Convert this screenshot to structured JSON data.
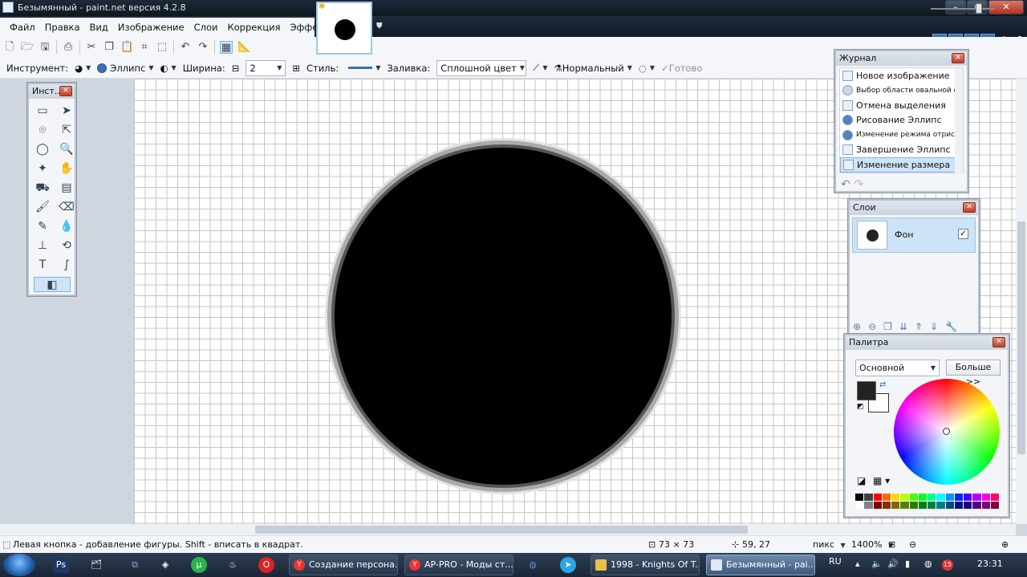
{
  "window": {
    "title": "Безымянный - paint.net версия 4.2.8",
    "buttons": [
      "–",
      "▫",
      "✕"
    ]
  },
  "menu": [
    "Файл",
    "Правка",
    "Вид",
    "Изображение",
    "Слои",
    "Коррекция",
    "Эффекты"
  ],
  "options": {
    "tool_label": "Инструмент:",
    "shape": "Эллипс",
    "width_label": "Ширина:",
    "width_value": "2",
    "style_label": "Стиль:",
    "fill_label": "Заливка:",
    "fill_value": "Сплошной цвет",
    "blend_mode": "Нормальный",
    "finish": "Готово"
  },
  "tools_panel": {
    "title": "Инст..."
  },
  "history": {
    "title": "Журнал",
    "items": [
      "Новое изображение",
      "Выбор области овальной формы",
      "Отмена выделения",
      "Рисование Эллипс",
      "Изменение режима отрисовки",
      "Завершение Эллипс",
      "Изменение размера"
    ]
  },
  "layers": {
    "title": "Слои",
    "layer_name": "Фон",
    "check": "✓"
  },
  "palette": {
    "title": "Палитра",
    "mode": "Основной",
    "more": "Больше >>",
    "swatches": [
      "#000000",
      "#404040",
      "#ff0000",
      "#ff6a00",
      "#ffd800",
      "#b6ff00",
      "#4cff00",
      "#00ff21",
      "#00ff90",
      "#00ffff",
      "#0094ff",
      "#0026ff",
      "#4800ff",
      "#b200ff",
      "#ff00dc",
      "#ff006e",
      "#ffffff",
      "#808080",
      "#7f0000",
      "#7f3300",
      "#7f6a00",
      "#5b7f00",
      "#267f00",
      "#007f0e",
      "#007f46",
      "#007f7f",
      "#004a7f",
      "#00137f",
      "#21007f",
      "#57007f",
      "#7f006e",
      "#7f0037"
    ],
    "primary_color": "#222222",
    "secondary_color": "#ffffff"
  },
  "status": {
    "hint": "Левая кнопка - добавление фигуры. Shift - вписать в квадрат.",
    "size": "73 × 73",
    "position": "59, 27",
    "unit": "пикс",
    "zoom": "1400%"
  },
  "taskbar": {
    "tasks": [
      "Создание персона...",
      "AP-PRO - Моды ст...",
      "1998 - Knights Of T...",
      "Безымянный - pai..."
    ],
    "lang": "RU",
    "time": "23:31",
    "badge": "15"
  }
}
